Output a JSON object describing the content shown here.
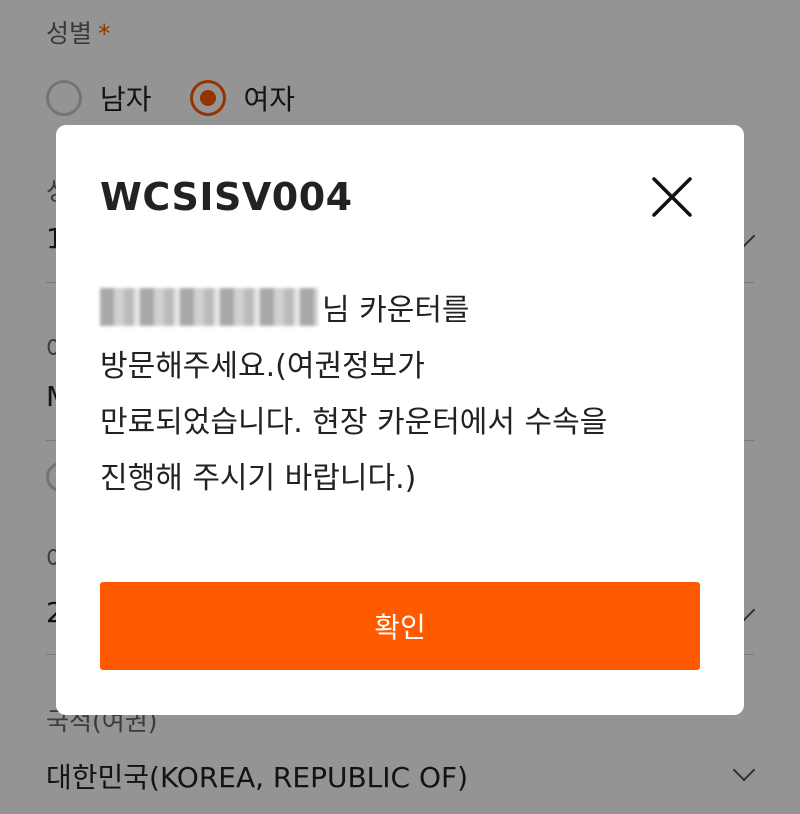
{
  "form": {
    "gender_label": "성별",
    "required_mark": "*",
    "gender_options": [
      "남자",
      "여자"
    ],
    "nationality_label": "국적(여권)",
    "nationality_value": "대한민국(KOREA, REPUBLIC OF)",
    "partial_label_1": "성",
    "partial_value_1": "1",
    "partial_label_2": "여",
    "partial_value_2": "M",
    "partial_label_3": "여",
    "partial_value_3": "2"
  },
  "modal": {
    "title": "WCSISV004",
    "message_line1": "님 카운터를",
    "message_line2": "방문해주세요.(여권정보가",
    "message_line3": "만료되었습니다. 현장 카운터에서 수속을",
    "message_line4": "진행해 주시기 바랍니다.)",
    "confirm_label": "확인"
  },
  "colors": {
    "accent": "#ff5a00",
    "overlay": "rgba(0,0,0,0.42)"
  },
  "icons": {
    "close": "close-icon",
    "dropdown": "chevron-down-icon"
  }
}
